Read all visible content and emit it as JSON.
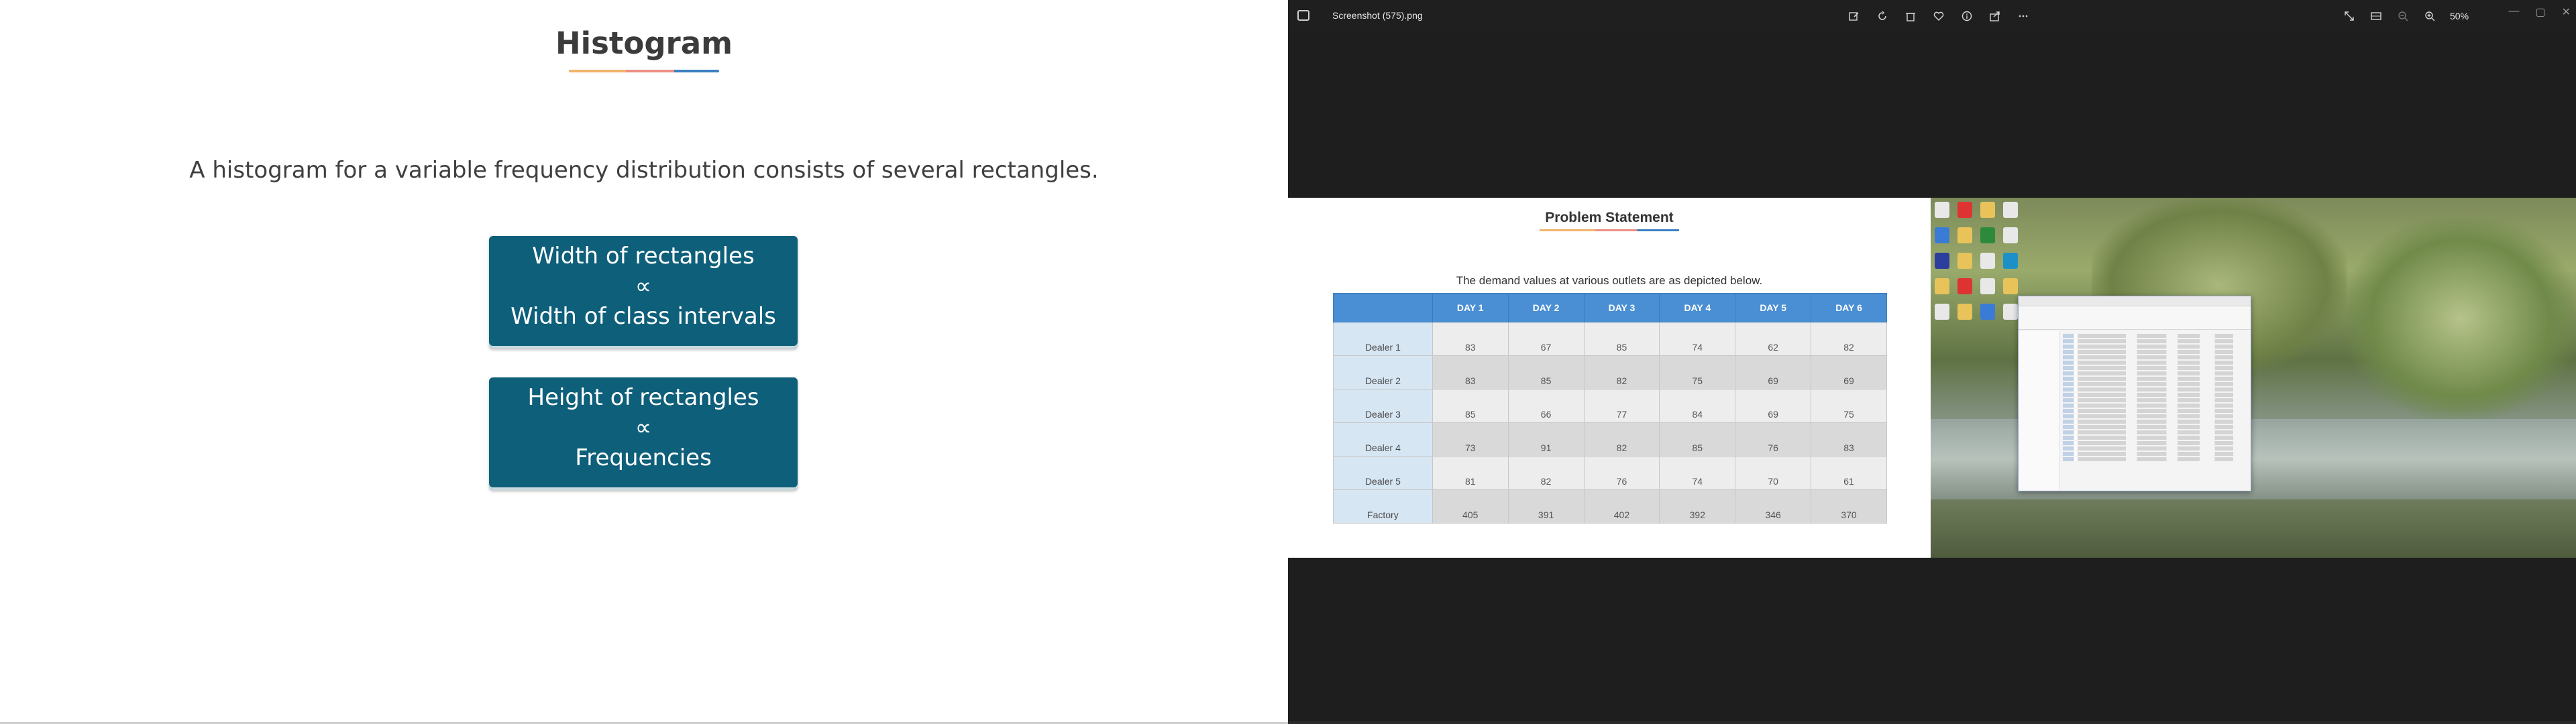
{
  "slide": {
    "title": "Histogram",
    "description": "A histogram for a variable frequency distribution consists of several rectangles.",
    "box1": {
      "line1": "Width of rectangles",
      "symbol": "∝",
      "line2": "Width of class intervals"
    },
    "box2": {
      "line1": "Height of rectangles",
      "symbol": "∝",
      "line2": "Frequencies"
    }
  },
  "viewer": {
    "filename": "Screenshot (575).png",
    "zoom": "50%",
    "toolbar_icons": [
      "edit-icon",
      "rotate-icon",
      "delete-icon",
      "favorite-icon",
      "info-icon",
      "share-icon",
      "more-icon"
    ],
    "right_icons": [
      "fullscreen-icon",
      "filmstrip-icon",
      "zoom-out-icon",
      "zoom-in-icon"
    ],
    "window_controls": {
      "minimize": "—",
      "maximize": "▢",
      "close": "✕"
    }
  },
  "embedded_slide": {
    "title": "Problem Statement",
    "description": "The demand values at various outlets are as depicted below.",
    "columns": [
      "DAY 1",
      "DAY 2",
      "DAY 3",
      "DAY 4",
      "DAY 5",
      "DAY 6"
    ],
    "rows": [
      {
        "label": "Dealer 1",
        "values": [
          "83",
          "67",
          "85",
          "74",
          "62",
          "82"
        ]
      },
      {
        "label": "Dealer 2",
        "values": [
          "83",
          "85",
          "82",
          "75",
          "69",
          "69"
        ]
      },
      {
        "label": "Dealer 3",
        "values": [
          "85",
          "66",
          "77",
          "84",
          "69",
          "75"
        ]
      },
      {
        "label": "Dealer 4",
        "values": [
          "73",
          "91",
          "82",
          "85",
          "76",
          "83"
        ]
      },
      {
        "label": "Dealer 5",
        "values": [
          "81",
          "82",
          "76",
          "74",
          "70",
          "61"
        ]
      },
      {
        "label": "Factory",
        "values": [
          "405",
          "391",
          "402",
          "392",
          "346",
          "370"
        ]
      }
    ]
  },
  "colors": {
    "slide_box": "#0e5f7a",
    "table_header": "#4a8fd3",
    "viewer_bg": "#1e1e1e"
  }
}
